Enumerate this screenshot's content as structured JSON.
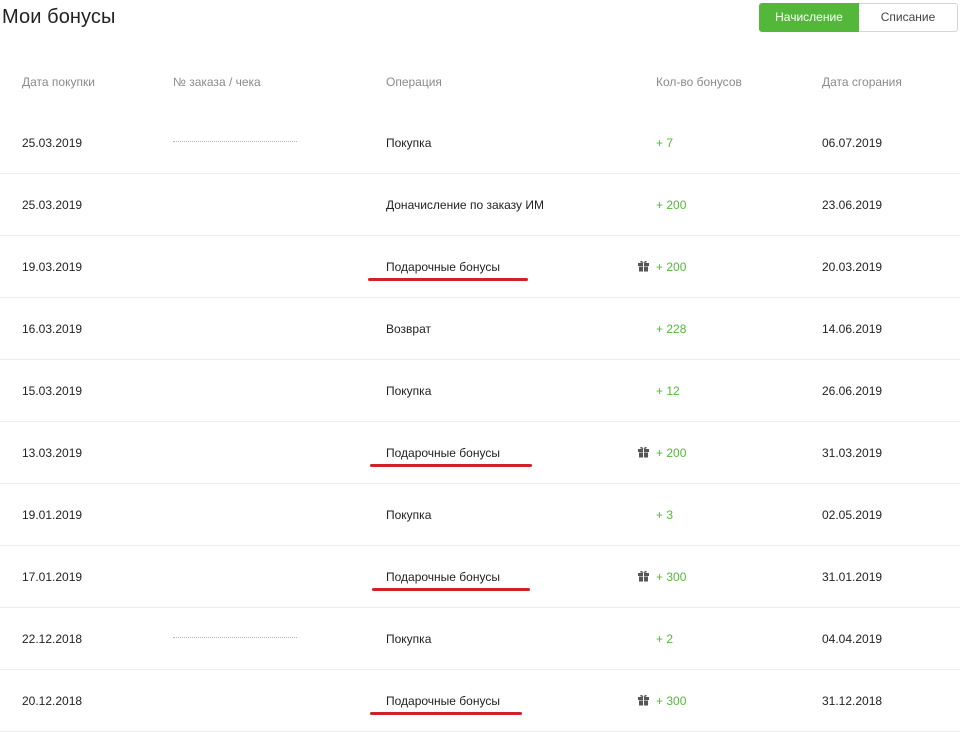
{
  "page": {
    "title": "Мои бонусы"
  },
  "toggle": {
    "accrual_label": "Начисление",
    "writeoff_label": "Списание",
    "accent_color": "#53b83a"
  },
  "table": {
    "columns": {
      "date": "Дата покупки",
      "order": "№ заказа / чека",
      "operation": "Операция",
      "amount": "Кол-во бонусов",
      "expire": "Дата сгорания"
    },
    "rows": [
      {
        "date": "25.03.2019",
        "order_redacted": true,
        "operation": "Покупка",
        "amount": "+ 7",
        "expire": "06.07.2019",
        "gift": false,
        "highlight": false
      },
      {
        "date": "25.03.2019",
        "order_redacted": false,
        "operation": "Доначисление по заказу ИМ",
        "amount": "+ 200",
        "expire": "23.06.2019",
        "gift": false,
        "highlight": false
      },
      {
        "date": "19.03.2019",
        "order_redacted": false,
        "operation": "Подарочные бонусы",
        "amount": "+ 200",
        "expire": "20.03.2019",
        "gift": true,
        "highlight": true
      },
      {
        "date": "16.03.2019",
        "order_redacted": false,
        "operation": "Возврат",
        "amount": "+ 228",
        "expire": "14.06.2019",
        "gift": false,
        "highlight": false
      },
      {
        "date": "15.03.2019",
        "order_redacted": false,
        "operation": "Покупка",
        "amount": "+ 12",
        "expire": "26.06.2019",
        "gift": false,
        "highlight": false
      },
      {
        "date": "13.03.2019",
        "order_redacted": false,
        "operation": "Подарочные бонусы",
        "amount": "+ 200",
        "expire": "31.03.2019",
        "gift": true,
        "highlight": true
      },
      {
        "date": "19.01.2019",
        "order_redacted": false,
        "operation": "Покупка",
        "amount": "+ 3",
        "expire": "02.05.2019",
        "gift": false,
        "highlight": false
      },
      {
        "date": "17.01.2019",
        "order_redacted": false,
        "operation": "Подарочные бонусы",
        "amount": "+ 300",
        "expire": "31.01.2019",
        "gift": true,
        "highlight": true
      },
      {
        "date": "22.12.2018",
        "order_redacted": true,
        "operation": "Покупка",
        "amount": "+ 2",
        "expire": "04.04.2019",
        "gift": false,
        "highlight": false
      },
      {
        "date": "20.12.2018",
        "order_redacted": false,
        "operation": "Подарочные бонусы",
        "amount": "+ 300",
        "expire": "31.12.2018",
        "gift": true,
        "highlight": true
      }
    ]
  },
  "icons": {
    "gift": "gift-icon"
  },
  "colors": {
    "highlight_underline": "#d0202a",
    "bonus_amount": "#53b83a"
  }
}
